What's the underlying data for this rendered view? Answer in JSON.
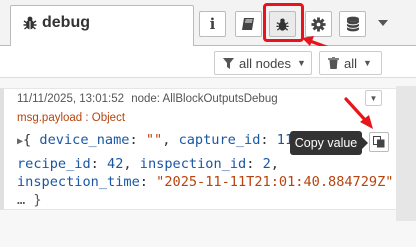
{
  "header": {
    "tab_label": "debug",
    "buttons": [
      {
        "icon": "info-icon"
      },
      {
        "icon": "book-icon"
      },
      {
        "icon": "bug-icon",
        "highlighted": true
      },
      {
        "icon": "gear-icon"
      },
      {
        "icon": "database-icon"
      },
      {
        "icon": "chevron-down-icon"
      }
    ]
  },
  "toolbar": {
    "nodes_filter": "all nodes",
    "clear_label": "all"
  },
  "message": {
    "timestamp": "11/11/2025, 13:01:52",
    "node": "node: AllBlockOutputsDebug",
    "topic": "msg.payload : Object",
    "line1_open": "{ ",
    "device_name_key": "device_name",
    "device_name_val": "\"\"",
    "capture_id_key": "capture_id",
    "capture_id_val": "11",
    "recipe_id_key": "recipe_id",
    "recipe_id_val": "42",
    "inspection_id_key": "inspection_id",
    "inspection_id_val": "2",
    "inspection_time_key": "inspection_time",
    "inspection_time_val": "\"2025-11-11T21:01:40.884729Z\"",
    "close": "… }"
  },
  "tooltip": {
    "text": "Copy value"
  },
  "colors": {
    "highlight": "#e8141b",
    "arrow": "#e8141b",
    "key": "#1a57a3",
    "string": "#b7440e"
  }
}
